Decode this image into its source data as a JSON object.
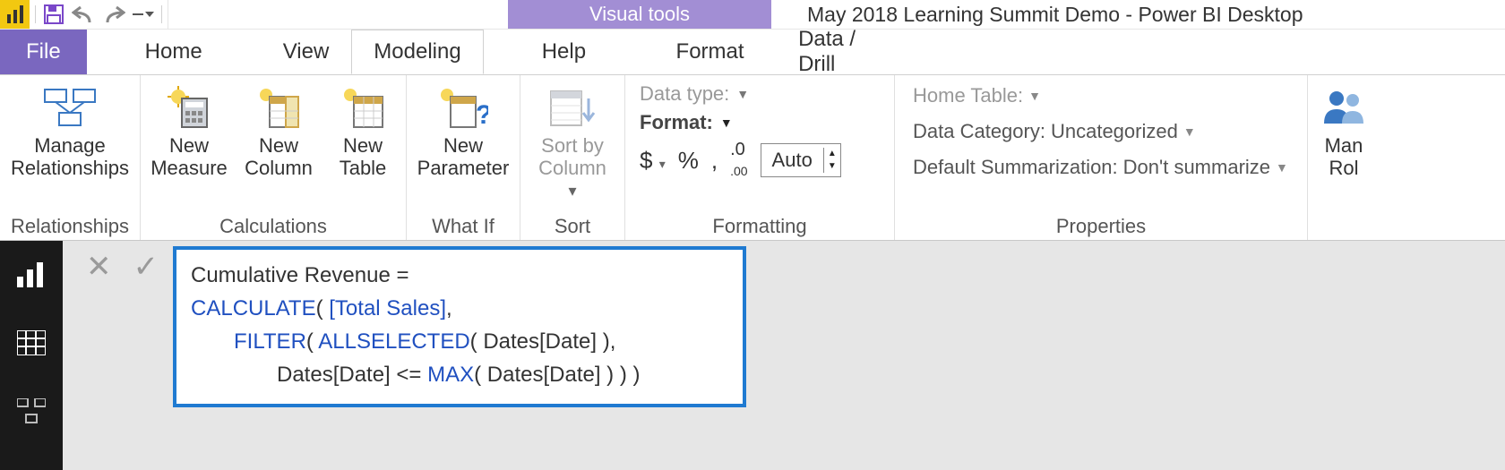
{
  "titlebar": {
    "contextual_tab": "Visual tools",
    "document_title": "May 2018 Learning Summit Demo - Power BI Desktop"
  },
  "tabs": {
    "file": "File",
    "home": "Home",
    "view": "View",
    "modeling": "Modeling",
    "help": "Help",
    "format": "Format",
    "datadrill": "Data / Drill"
  },
  "ribbon": {
    "relationships": {
      "manage": "Manage\nRelationships",
      "group": "Relationships"
    },
    "calculations": {
      "measure": "New\nMeasure",
      "column": "New\nColumn",
      "table": "New\nTable",
      "group": "Calculations"
    },
    "whatif": {
      "param": "New\nParameter",
      "group": "What If"
    },
    "sort": {
      "sortby": "Sort by\nColumn",
      "group": "Sort"
    },
    "formatting": {
      "datatype_label": "Data type:",
      "format_label": "Format:",
      "spin_value": "Auto",
      "group": "Formatting"
    },
    "properties": {
      "home_table": "Home Table:",
      "data_cat_label": "Data Category:",
      "data_cat_value": "Uncategorized",
      "def_sum_label": "Default Summarization:",
      "def_sum_value": "Don't summarize",
      "group": "Properties"
    },
    "security": {
      "manage": "Man\nRol"
    }
  },
  "formula": {
    "line1_a": "Cumulative Revenue = ",
    "line2_kw": "CALCULATE",
    "line2_a": "( ",
    "line2_col": "[Total Sales]",
    "line2_b": ",",
    "line3_kw": "FILTER",
    "line3_a": "( ",
    "line3_kw2": "ALLSELECTED",
    "line3_b": "( Dates[Date] ),",
    "line4_a": "Dates[Date] <= ",
    "line4_kw": "MAX",
    "line4_b": "( Dates[Date] ) ) )"
  }
}
